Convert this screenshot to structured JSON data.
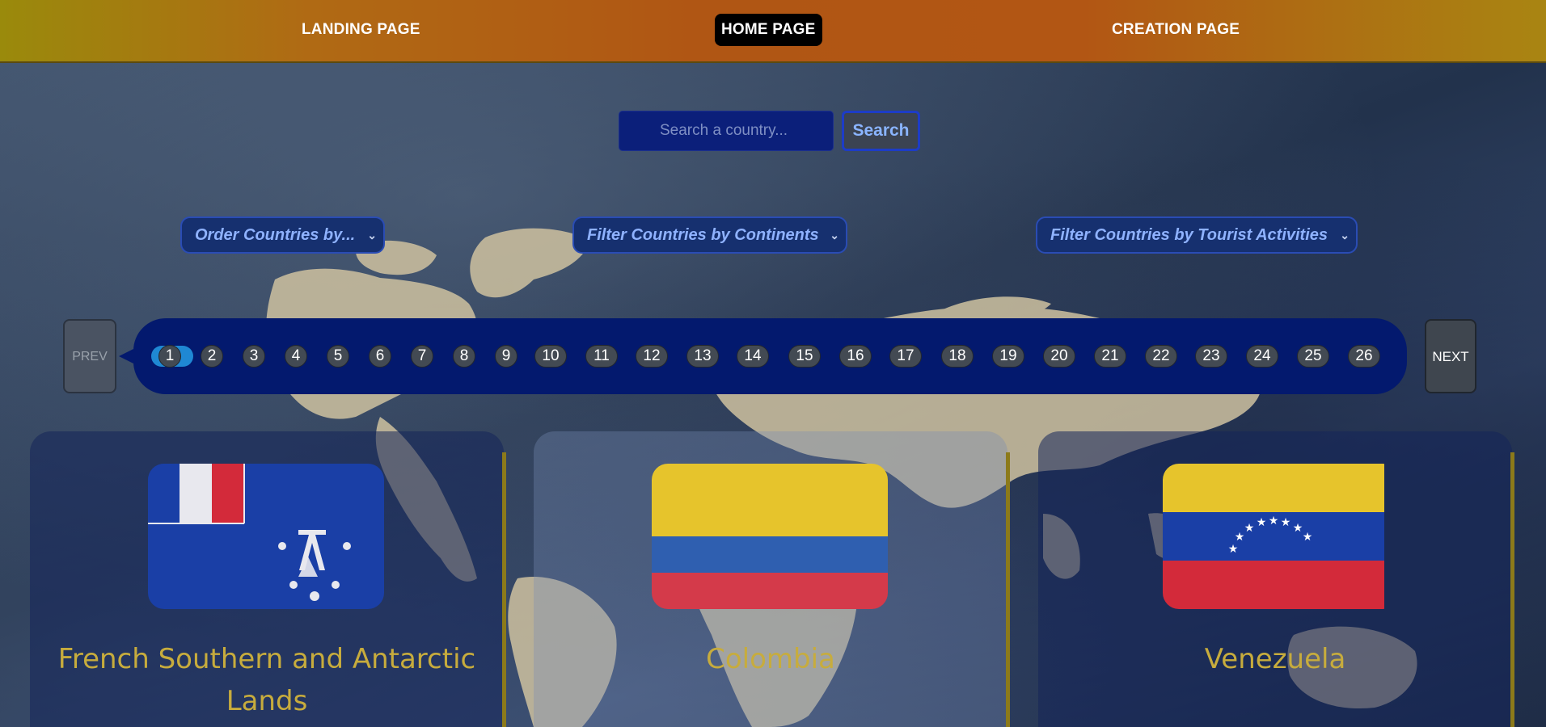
{
  "nav": {
    "links": [
      {
        "label": "LANDING PAGE"
      },
      {
        "label": "HOME PAGE"
      },
      {
        "label": "CREATION PAGE"
      }
    ],
    "active": "HOME PAGE"
  },
  "search": {
    "placeholder": "Search a country...",
    "button_label": "Search"
  },
  "filters": {
    "order": "Order Countries by...",
    "continents": "Filter Countries by Continents",
    "activities": "Filter Countries by Tourist Activities"
  },
  "pagination": {
    "prev_label": "PREV",
    "next_label": "NEXT",
    "pages": [
      "1",
      "2",
      "3",
      "4",
      "5",
      "6",
      "7",
      "8",
      "9",
      "10",
      "11",
      "12",
      "13",
      "14",
      "15",
      "16",
      "17",
      "18",
      "19",
      "20",
      "21",
      "22",
      "23",
      "24",
      "25",
      "26"
    ],
    "current": "1"
  },
  "cards": [
    {
      "name": "French Southern and Antarctic Lands",
      "flag": "french-southern-antarctic-lands-flag"
    },
    {
      "name": "Colombia",
      "flag": "colombia-flag"
    },
    {
      "name": "Venezuela",
      "flag": "venezuela-flag"
    }
  ],
  "colors": {
    "nav_gradient": [
      "#9a8a0c",
      "#b05614"
    ],
    "pager_bg": "#03196e",
    "card_title": "#c7ac3d",
    "active_page": "#1f88d4"
  }
}
